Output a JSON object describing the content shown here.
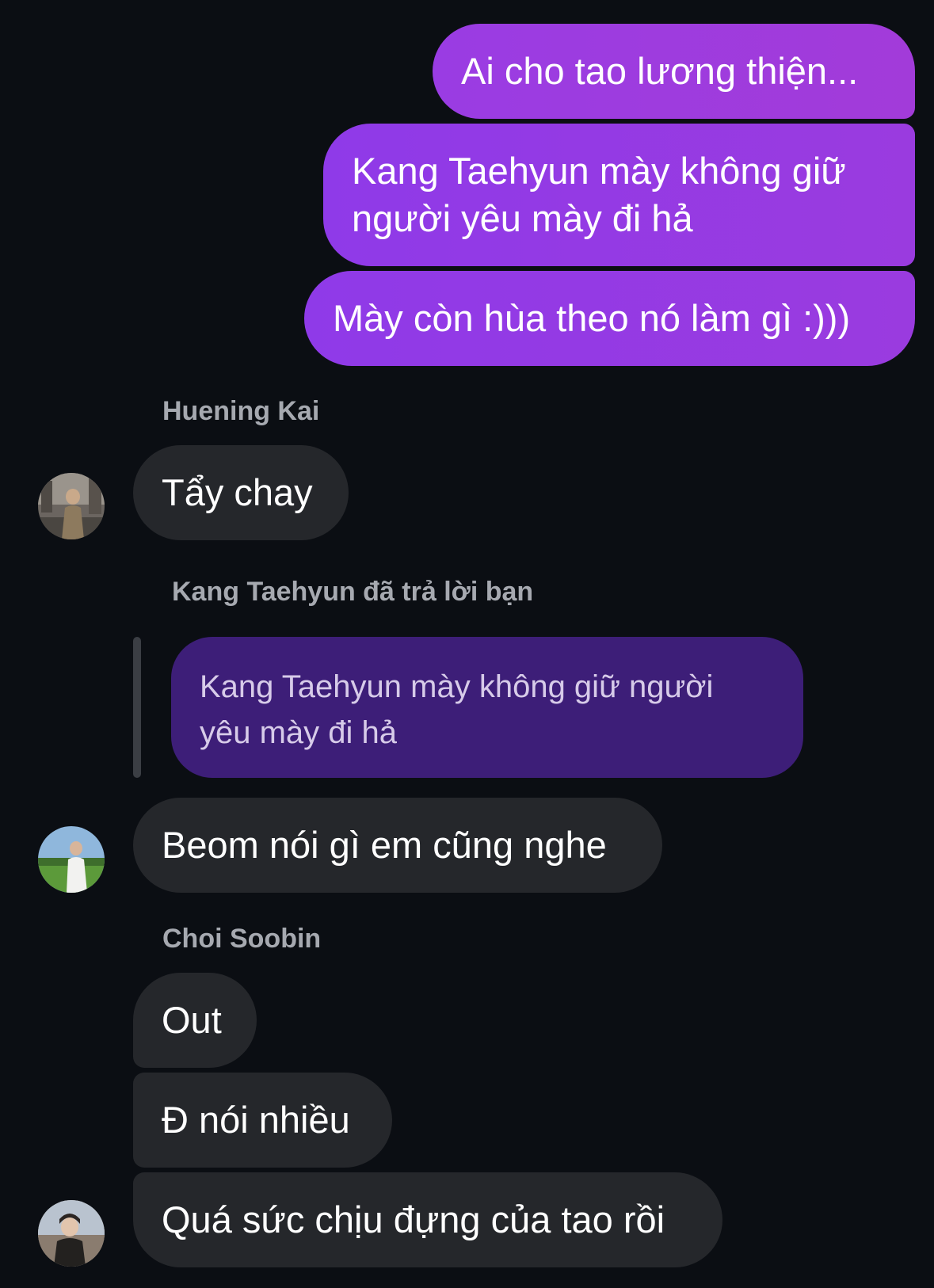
{
  "sent_messages": [
    "Ai cho tao lương thiện...",
    "Kang Taehyun mày không giữ người yêu mày đi hả",
    "Mày còn hùa theo nó làm gì :)))"
  ],
  "sent_line2": {
    "line1": "Kang Taehyun mày không giữ",
    "line2": "người yêu mày đi hả"
  },
  "group1": {
    "sender": "Huening Kai",
    "message": "Tẩy chay"
  },
  "reply": {
    "label": "Kang Taehyun đã trả lời bạn",
    "quote_line1": "Kang Taehyun mày không giữ người",
    "quote_line2": "yêu mày đi hả",
    "message": "Beom nói gì em cũng nghe"
  },
  "group3": {
    "sender": "Choi Soobin",
    "messages": [
      "Out",
      "Đ nói nhiều",
      "Quá sức chịu đựng của tao rồi"
    ]
  },
  "colors": {
    "background": "#0b0e13",
    "sent_bubble": "#9a3ce3",
    "received_bubble": "#25272b",
    "reply_quote": "#3d1e78",
    "name_text": "#a6a9b0"
  }
}
